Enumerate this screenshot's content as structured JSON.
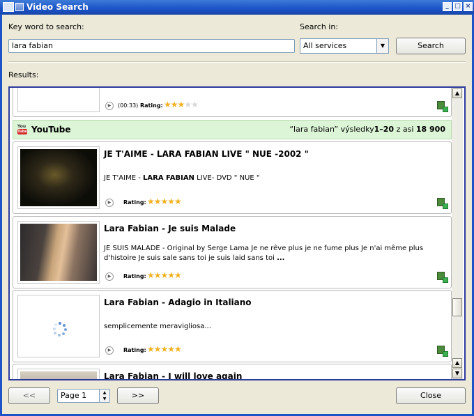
{
  "window": {
    "title": "Video Search",
    "min_label": "_",
    "max_label": "□",
    "close_label": "×"
  },
  "search": {
    "keyword_label": "Key word to search:",
    "keyword_value": "lara fabian",
    "search_in_label": "Search in:",
    "service_value": "All services",
    "search_button": "Search"
  },
  "results_label": "Results:",
  "partial_item": {
    "duration": "(00:33)",
    "rating_label": "Rating:",
    "rating": 2.5
  },
  "provider": {
    "name": "YouTube",
    "query": "“lara fabian”",
    "results_word": "výsledky",
    "range": "1–20",
    "approx": "z asi",
    "total": "18 900"
  },
  "videos": [
    {
      "title": "JE T'AIME - LARA FABIAN LIVE \" NUE -2002 \"",
      "desc_pre": "JE T'AIME - ",
      "desc_bold": "LARA FABIAN",
      "desc_post": " LIVE- DVD \" NUE \"",
      "rating_label": "Rating:",
      "rating": 5
    },
    {
      "title": "Lara Fabian - Je suis Malade",
      "desc_pre": "JE SUIS MALADE - Original by Serge Lama Je ne rêve plus je ne fume plus Je n'ai même plus d'histoire Je suis sale sans toi je suis laid sans toi ",
      "desc_bold": "...",
      "desc_post": "",
      "rating_label": "Rating:",
      "rating": 5
    },
    {
      "title": "Lara Fabian - Adagio in Italiano",
      "desc_pre": "semplicemente meravigliosa...",
      "desc_bold": "",
      "desc_post": "",
      "rating_label": "Rating:",
      "rating": 5
    },
    {
      "title": "Lara Fabian - I will love again"
    }
  ],
  "footer": {
    "prev_button": "<<",
    "page_value": "Page 1",
    "next_button": ">>",
    "close_button": "Close"
  },
  "colors": {
    "titlebar": "#1c54c8",
    "youtube_bar": "#dcf5d6",
    "results_border": "#2c3a9c",
    "star": "#f0b020"
  }
}
